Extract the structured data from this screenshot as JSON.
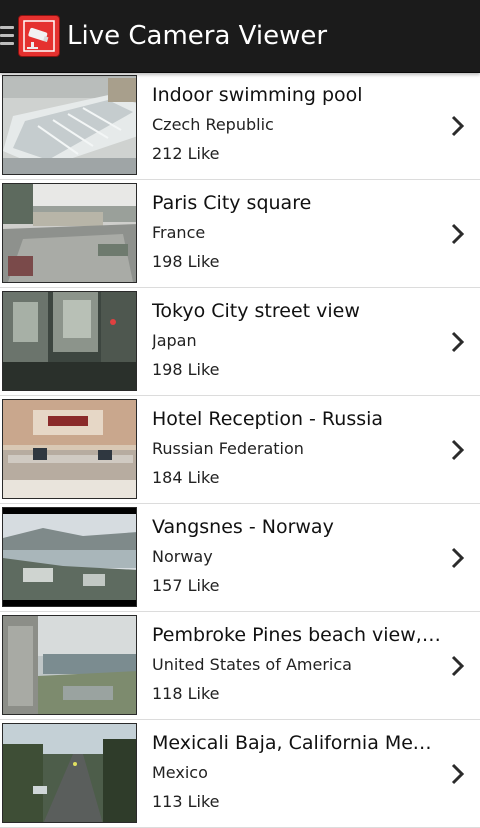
{
  "app": {
    "title": "Live Camera Viewer",
    "icons": {
      "menu": "menu-icon",
      "logo": "security-camera-icon",
      "row_action": "chevron-right-icon"
    },
    "colors": {
      "appbar": "#1b1b1b",
      "logo_bg": "#e5312f",
      "text": "#111111",
      "divider": "#dcdcdc"
    }
  },
  "cameras": [
    {
      "name": "Indoor swimming pool",
      "country": "Czech Republic",
      "likes": "212 Like"
    },
    {
      "name": "Paris City square",
      "country": "France",
      "likes": "198 Like"
    },
    {
      "name": "Tokyo City street view",
      "country": "Japan",
      "likes": "198 Like"
    },
    {
      "name": "Hotel Reception - Russia",
      "country": "Russian Federation",
      "likes": "184 Like"
    },
    {
      "name": "Vangsnes - Norway",
      "country": "Norway",
      "likes": "157 Like"
    },
    {
      "name": "Pembroke Pines beach view, F...",
      "country": "United States of America",
      "likes": "118 Like"
    },
    {
      "name": "Mexicali Baja, California Mexic...",
      "country": "Mexico",
      "likes": "113 Like"
    }
  ]
}
